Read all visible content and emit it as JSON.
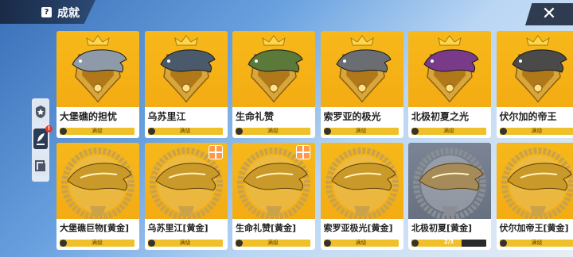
{
  "header": {
    "title": "成就",
    "help_icon": "?",
    "close_icon": "✕"
  },
  "sidebar": {
    "badge": "!"
  },
  "cards": [
    {
      "name": "大堡礁的担忧",
      "level": "满级",
      "fish": "#8e9aa8",
      "gold": true
    },
    {
      "name": "乌苏里江",
      "level": "满级",
      "fish": "#4a5a6a",
      "gold": true
    },
    {
      "name": "生命礼赞",
      "level": "满级",
      "fish": "#5b7a3a",
      "gold": true
    },
    {
      "name": "索罗亚的极光",
      "level": "满级",
      "fish": "#6a6e72",
      "gold": true
    },
    {
      "name": "北极初夏之光",
      "level": "满级",
      "fish": "#7a3a8a",
      "gold": true
    },
    {
      "name": "伏尔加的帝王",
      "level": "满级",
      "fish": "#4a4a4a",
      "gold": true
    },
    {
      "name": "大堡礁巨物[黄金]",
      "level": "满级",
      "fish": "#c99a2a",
      "gold": true,
      "small": true
    },
    {
      "name": "乌苏里江[黄金]",
      "level": "满级",
      "fish": "#c99a2a",
      "gold": true,
      "gift": true,
      "small": true
    },
    {
      "name": "生命礼赞[黄金]",
      "level": "满级",
      "fish": "#c99a2a",
      "gold": true,
      "gift": true,
      "small": true
    },
    {
      "name": "索罗亚极光[黄金]",
      "level": "满级",
      "fish": "#c99a2a",
      "gold": true,
      "small": true
    },
    {
      "name": "北极初夏[黄金]",
      "level": "2/3",
      "progress": 0.67,
      "fish": "#a58a5a",
      "gold": false,
      "small": true
    },
    {
      "name": "伏尔加帝王[黄金]",
      "level": "满级",
      "fish": "#c99a2a",
      "gold": true,
      "small": true
    }
  ],
  "colors": {
    "card_gold": "#f7b81a",
    "card_dark": "#6a7484",
    "bar": "#f0c02a"
  }
}
